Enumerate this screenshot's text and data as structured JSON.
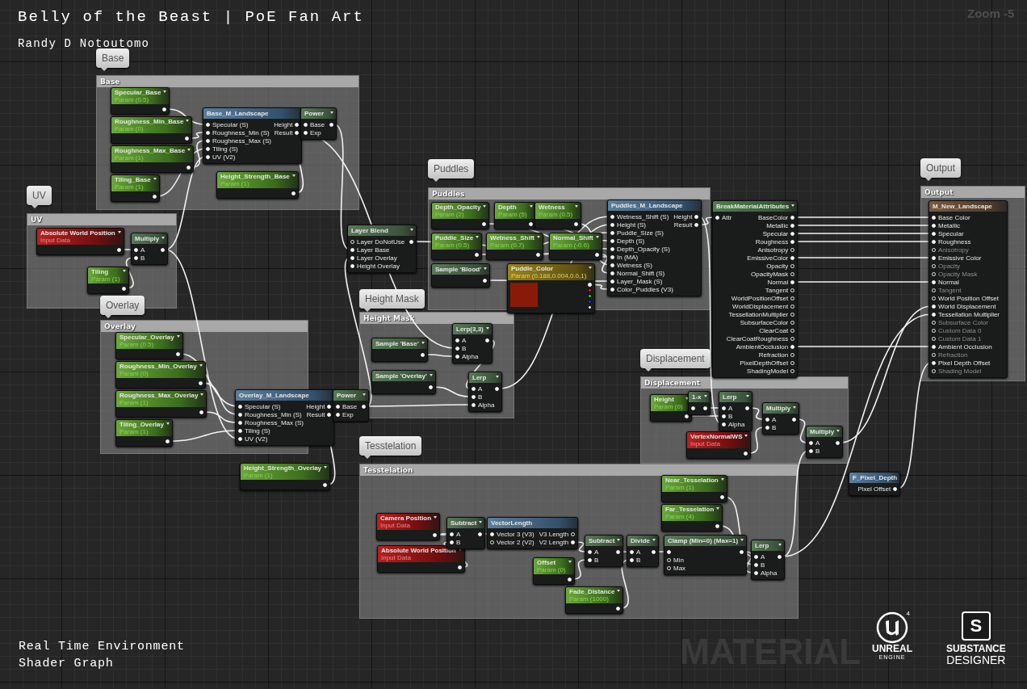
{
  "header": {
    "title": "Belly of the Beast | PoE Fan Art",
    "author": "Randy D Notoutomo"
  },
  "zoom": "Zoom -5",
  "graph": {
    "watermark": "MATERIAL",
    "comments": [
      {
        "bubble": "Base",
        "title": "Base"
      },
      {
        "bubble": "UV",
        "title": "UV"
      },
      {
        "bubble": "Overlay",
        "title": "Overlay"
      },
      {
        "bubble": "Puddles",
        "title": "Puddles"
      },
      {
        "bubble": "Height Mask",
        "title": "Height Mask"
      },
      {
        "bubble": "Displacement",
        "title": "Displacement"
      },
      {
        "bubble": "Tesstelation",
        "title": "Tesstelation"
      },
      {
        "bubble": "Output",
        "title": "Output"
      }
    ],
    "nodes": [
      {
        "kind": "param",
        "title": "Specular_Base",
        "subtitle": "Param (0.5)",
        "outputs": [
          {
            "connected": true
          }
        ]
      },
      {
        "kind": "param",
        "title": "Roughness_Min_Base",
        "subtitle": "Param (0)",
        "outputs": [
          {
            "connected": true
          }
        ]
      },
      {
        "kind": "param",
        "title": "Roughness_Max_Base",
        "subtitle": "Param (1)",
        "outputs": [
          {
            "connected": true
          }
        ]
      },
      {
        "kind": "param",
        "title": "Tiling_Base",
        "subtitle": "Param (1)",
        "outputs": [
          {
            "connected": true
          }
        ]
      },
      {
        "kind": "function",
        "title": "Base_M_Landscape",
        "inputs": [
          {
            "label": "Specular (S)",
            "connected": true
          },
          {
            "label": "Roughness_Min (S)",
            "connected": true
          },
          {
            "label": "Roughness_Max (S)",
            "connected": true
          },
          {
            "label": "Tiling (S)",
            "connected": true
          },
          {
            "label": "UV (V2)",
            "connected": true
          }
        ],
        "outputs": [
          {
            "label": "Height",
            "connected": true
          },
          {
            "label": "Result",
            "connected": true
          }
        ]
      },
      {
        "kind": "math",
        "title": "Power",
        "inputs": [
          {
            "label": "Base",
            "connected": true
          },
          {
            "label": "Exp",
            "connected": true
          }
        ],
        "outputs": [
          {
            "connected": true
          }
        ]
      },
      {
        "kind": "param",
        "title": "Height_Strength_Base",
        "subtitle": "Param (1)",
        "outputs": [
          {
            "connected": true
          }
        ]
      },
      {
        "kind": "input",
        "title": "Absolute World Position",
        "subtitle": "Input Data",
        "outputs": [
          {
            "connected": true
          }
        ]
      },
      {
        "kind": "math",
        "title": "Multiply",
        "inputs": [
          {
            "label": "A",
            "connected": true
          },
          {
            "label": "B",
            "connected": true
          }
        ],
        "outputs": [
          {
            "connected": true
          }
        ]
      },
      {
        "kind": "param",
        "title": "Tiling",
        "subtitle": "Param (1)",
        "outputs": [
          {
            "connected": true
          }
        ]
      },
      {
        "kind": "param",
        "title": "Specular_Overlay",
        "subtitle": "Param (0.5)",
        "outputs": [
          {
            "connected": true
          }
        ]
      },
      {
        "kind": "param",
        "title": "Roughness_Min_Overlay",
        "subtitle": "Param (0)",
        "outputs": [
          {
            "connected": true
          }
        ]
      },
      {
        "kind": "param",
        "title": "Roughness_Max_Overlay",
        "subtitle": "Param (1)",
        "outputs": [
          {
            "connected": true
          }
        ]
      },
      {
        "kind": "param",
        "title": "Tiling_Overlay",
        "subtitle": "Param (1)",
        "outputs": [
          {
            "connected": true
          }
        ]
      },
      {
        "kind": "function",
        "title": "Overlay_M_Landscape",
        "inputs": [
          {
            "label": "Specular (S)",
            "connected": true
          },
          {
            "label": "Roughness_Min (S)",
            "connected": true
          },
          {
            "label": "Roughness_Max (S)",
            "connected": true
          },
          {
            "label": "Tiling (S)",
            "connected": true
          },
          {
            "label": "UV (V2)",
            "connected": true
          }
        ],
        "outputs": [
          {
            "label": "Height",
            "connected": true
          },
          {
            "label": "Result",
            "connected": true
          }
        ]
      },
      {
        "kind": "math",
        "title": "Power",
        "inputs": [
          {
            "label": "Base",
            "connected": true
          },
          {
            "label": "Exp",
            "connected": true
          }
        ],
        "outputs": [
          {
            "connected": true
          }
        ]
      },
      {
        "kind": "param",
        "title": "Height_Strength_Overlay",
        "subtitle": "Param (1)",
        "outputs": [
          {
            "connected": true
          }
        ]
      },
      {
        "kind": "math",
        "title": "Layer Blend",
        "inputs": [
          {
            "label": "Layer DoNotUse",
            "connected": false
          },
          {
            "label": "Layer Base",
            "connected": true
          },
          {
            "label": "Layer Overlay",
            "connected": true
          },
          {
            "label": "Height Overlay",
            "connected": true
          }
        ],
        "outputs": [
          {
            "connected": true
          }
        ]
      },
      {
        "kind": "param",
        "title": "Depth_Opacity",
        "subtitle": "Param (2)",
        "outputs": [
          {
            "connected": true
          }
        ]
      },
      {
        "kind": "param",
        "title": "Depth",
        "subtitle": "Param (5)",
        "outputs": [
          {
            "connected": true
          }
        ]
      },
      {
        "kind": "param",
        "title": "Wetness",
        "subtitle": "Param (0.5)",
        "outputs": [
          {
            "connected": true
          }
        ]
      },
      {
        "kind": "param",
        "title": "Puddle_Size",
        "subtitle": "Param (0.5)",
        "outputs": [
          {
            "connected": true
          }
        ]
      },
      {
        "kind": "param",
        "title": "Wetness_Shift",
        "subtitle": "Param (0.7)",
        "outputs": [
          {
            "connected": true
          }
        ]
      },
      {
        "kind": "param",
        "title": "Normal_Shift",
        "subtitle": "Param (-0.6)",
        "outputs": [
          {
            "connected": true
          }
        ]
      },
      {
        "kind": "math",
        "title": "Sample 'Blood'",
        "outputs": [
          {
            "connected": true
          }
        ]
      },
      {
        "kind": "color",
        "title": "Puddle_Color",
        "subtitle": "Param (0.188,0.004,0.0,1)",
        "color": "#8a1a08",
        "outputs": [
          {
            "connected": true,
            "color": "#ffffff"
          },
          {
            "connected": false,
            "color": "#ff2020"
          },
          {
            "connected": false,
            "color": "#20e020"
          },
          {
            "connected": false,
            "color": "#2040ff"
          },
          {
            "connected": false,
            "color": "#ffffff"
          }
        ]
      },
      {
        "kind": "function",
        "title": "Puddles_M_Landscape",
        "inputs": [
          {
            "label": "Wetness_Shift (S)",
            "connected": true
          },
          {
            "label": "Height (S)",
            "connected": true
          },
          {
            "label": "Puddle_Size (S)",
            "connected": true
          },
          {
            "label": "Depth (S)",
            "connected": true
          },
          {
            "label": "Depth_Opacity (S)",
            "connected": true
          },
          {
            "label": "In (MA)",
            "connected": true
          },
          {
            "label": "Wetness (S)",
            "connected": true
          },
          {
            "label": "Normal_Shift (S)",
            "connected": true
          },
          {
            "label": "Layer_Mask (S)",
            "connected": true
          },
          {
            "label": "Color_Puddles (V3)",
            "connected": true
          }
        ],
        "outputs": [
          {
            "label": "Height",
            "connected": true
          },
          {
            "label": "Result",
            "connected": true
          }
        ]
      },
      {
        "kind": "math",
        "title": "Sample 'Base'",
        "outputs": [
          {
            "connected": true
          }
        ]
      },
      {
        "kind": "math",
        "title": "Sample 'Overlay'",
        "outputs": [
          {
            "connected": true
          }
        ]
      },
      {
        "kind": "math",
        "title": "Lerp(3,3)",
        "inputs": [
          {
            "label": "A",
            "connected": true
          },
          {
            "label": "B",
            "connected": true
          },
          {
            "label": "Alpha",
            "connected": true
          }
        ],
        "outputs": [
          {
            "connected": true
          }
        ]
      },
      {
        "kind": "math",
        "title": "Lerp",
        "inputs": [
          {
            "label": "A",
            "connected": true
          },
          {
            "label": "B",
            "connected": true
          },
          {
            "label": "Alpha",
            "connected": true
          }
        ],
        "outputs": [
          {
            "connected": true
          }
        ]
      },
      {
        "kind": "break",
        "title": "BreakMaterialAttributes",
        "inputs": [
          {
            "label": "Attr",
            "connected": true
          }
        ],
        "outputs": [
          {
            "label": "BaseColor",
            "connected": true
          },
          {
            "label": "Metallic",
            "connected": true
          },
          {
            "label": "Specular",
            "connected": true
          },
          {
            "label": "Roughness",
            "connected": true
          },
          {
            "label": "Anisotropy",
            "connected": false
          },
          {
            "label": "EmissiveColor",
            "connected": true
          },
          {
            "label": "Opacity",
            "connected": false
          },
          {
            "label": "OpacityMask",
            "connected": false
          },
          {
            "label": "Normal",
            "connected": true
          },
          {
            "label": "Tangent",
            "connected": false
          },
          {
            "label": "WorldPositionOffset",
            "connected": false
          },
          {
            "label": "WorldDisplacement",
            "connected": false
          },
          {
            "label": "TessellationMultiplier",
            "connected": false
          },
          {
            "label": "SubsurfaceColor",
            "connected": false
          },
          {
            "label": "ClearCoat",
            "connected": false
          },
          {
            "label": "ClearCoatRoughness",
            "connected": false
          },
          {
            "label": "AmbientOcclusion",
            "connected": true
          },
          {
            "label": "Refraction",
            "connected": false
          },
          {
            "label": "PixelDepthOffset",
            "connected": false
          },
          {
            "label": "ShadingModel",
            "connected": false
          }
        ]
      },
      {
        "kind": "result",
        "title": "M_New_Landscape",
        "inputs": [
          {
            "label": "Base Color",
            "connected": true,
            "disabled": false
          },
          {
            "label": "Metallic",
            "connected": true,
            "disabled": false
          },
          {
            "label": "Specular",
            "connected": true,
            "disabled": false
          },
          {
            "label": "Roughness",
            "connected": true,
            "disabled": false
          },
          {
            "label": "Anisotropy",
            "connected": false,
            "disabled": true
          },
          {
            "label": "Emissive Color",
            "connected": true,
            "disabled": false
          },
          {
            "label": "Opacity",
            "connected": false,
            "disabled": true
          },
          {
            "label": "Opacity Mask",
            "connected": false,
            "disabled": true
          },
          {
            "label": "Normal",
            "connected": true,
            "disabled": false
          },
          {
            "label": "Tangent",
            "connected": false,
            "disabled": true
          },
          {
            "label": "World Position Offset",
            "connected": false,
            "disabled": false
          },
          {
            "label": "World Displacement",
            "connected": true,
            "disabled": false
          },
          {
            "label": "Tessellation Multiplier",
            "connected": true,
            "disabled": false
          },
          {
            "label": "Subsurface Color",
            "connected": false,
            "disabled": true
          },
          {
            "label": "Custom Data 0",
            "connected": false,
            "disabled": true
          },
          {
            "label": "Custom Data 1",
            "connected": false,
            "disabled": true
          },
          {
            "label": "Ambient Occlusion",
            "connected": true,
            "disabled": false
          },
          {
            "label": "Refraction",
            "connected": false,
            "disabled": true
          },
          {
            "label": "Pixel Depth Offset",
            "connected": true,
            "disabled": false
          },
          {
            "label": "Shading Model",
            "connected": false,
            "disabled": true
          }
        ]
      },
      {
        "kind": "param",
        "title": "Height",
        "subtitle": "Param (0)",
        "outputs": [
          {
            "connected": true
          }
        ]
      },
      {
        "kind": "math",
        "title": "1-x",
        "inputs": [
          {
            "connected": true
          }
        ],
        "outputs": [
          {
            "connected": true
          }
        ]
      },
      {
        "kind": "math",
        "title": "Lerp",
        "inputs": [
          {
            "label": "A",
            "connected": true
          },
          {
            "label": "B",
            "connected": true
          },
          {
            "label": "Alpha",
            "connected": true
          }
        ],
        "outputs": [
          {
            "connected": true
          }
        ]
      },
      {
        "kind": "math",
        "title": "Multiply",
        "inputs": [
          {
            "label": "A",
            "connected": true
          },
          {
            "label": "B",
            "connected": true
          }
        ],
        "outputs": [
          {
            "connected": true
          }
        ]
      },
      {
        "kind": "input",
        "title": "VertexNormalWS",
        "subtitle": "Input Data",
        "outputs": [
          {
            "connected": true
          }
        ]
      },
      {
        "kind": "math",
        "title": "Multiply",
        "inputs": [
          {
            "label": "A",
            "connected": true
          },
          {
            "label": "B",
            "connected": true
          }
        ],
        "outputs": [
          {
            "connected": true
          }
        ]
      },
      {
        "kind": "function",
        "title": "F_Pixel_Depth",
        "outputs": [
          {
            "label": "Pixel Offset",
            "connected": true
          }
        ]
      },
      {
        "kind": "input",
        "title": "Camera Position",
        "subtitle": "Input Data",
        "outputs": [
          {
            "connected": true
          }
        ]
      },
      {
        "kind": "input",
        "title": "Absolute World Position",
        "subtitle": "Input Data",
        "outputs": [
          {
            "connected": true
          }
        ]
      },
      {
        "kind": "math",
        "title": "Subtract",
        "inputs": [
          {
            "label": "A",
            "connected": true
          },
          {
            "label": "B",
            "connected": true
          }
        ],
        "outputs": [
          {
            "connected": true
          }
        ]
      },
      {
        "kind": "function",
        "title": "VectorLength",
        "inputs": [
          {
            "label": "Vector 3 (V3)",
            "connected": true
          },
          {
            "label": "Vector 2 (V2)",
            "connected": false
          }
        ],
        "outputs": [
          {
            "label": "V3 Length",
            "connected": false
          },
          {
            "label": "V2 Length",
            "connected": true
          }
        ]
      },
      {
        "kind": "math",
        "title": "Subtract",
        "inputs": [
          {
            "label": "A",
            "connected": true
          },
          {
            "label": "B",
            "connected": true
          }
        ],
        "outputs": [
          {
            "connected": true
          }
        ]
      },
      {
        "kind": "param",
        "title": "Offset",
        "subtitle": "Param (0)",
        "outputs": [
          {
            "connected": true
          }
        ]
      },
      {
        "kind": "math",
        "title": "Divide",
        "inputs": [
          {
            "label": "A",
            "connected": true
          },
          {
            "label": "B",
            "connected": true
          }
        ],
        "outputs": [
          {
            "connected": true
          }
        ]
      },
      {
        "kind": "math",
        "title": "Clamp (Min=0) (Max=1)",
        "inputs": [
          {
            "connected": true
          },
          {
            "label": "Min",
            "connected": false
          },
          {
            "label": "Max",
            "connected": false
          }
        ],
        "outputs": [
          {
            "connected": true
          }
        ]
      },
      {
        "kind": "param",
        "title": "Fade_Distance",
        "subtitle": "Param (1000)",
        "outputs": [
          {
            "connected": true
          }
        ]
      },
      {
        "kind": "param",
        "title": "Near_Tesselation",
        "subtitle": "Param (1)",
        "outputs": [
          {
            "connected": true
          }
        ]
      },
      {
        "kind": "param",
        "title": "Far_Tesselation",
        "subtitle": "Param (4)",
        "outputs": [
          {
            "connected": true
          }
        ]
      },
      {
        "kind": "math",
        "title": "Lerp",
        "inputs": [
          {
            "label": "A",
            "connected": true
          },
          {
            "label": "B",
            "connected": true
          },
          {
            "label": "Alpha",
            "connected": true
          }
        ],
        "outputs": [
          {
            "connected": true
          }
        ]
      }
    ]
  },
  "caption": [
    "Real Time Environment",
    "Shader Graph"
  ],
  "logos": {
    "unreal": {
      "mark": "4",
      "name": "UNREAL",
      "sub": "ENGINE"
    },
    "substance": {
      "letter": "S",
      "name": "SUBSTANCE",
      "sub": "DESIGNER"
    }
  }
}
